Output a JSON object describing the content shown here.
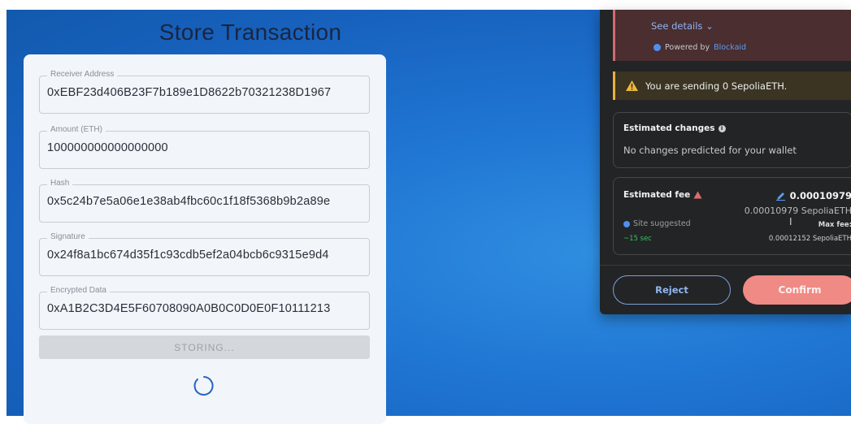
{
  "store": {
    "title": "Store Transaction",
    "fields": [
      {
        "label": "Receiver Address",
        "value": "0xEBF23d406B23F7b189e1D8622b70321238D1967"
      },
      {
        "label": "Amount (ETH)",
        "value": "100000000000000000"
      },
      {
        "label": "Hash",
        "value": "0x5c24b7e5a06e1e38ab4fbc60c1f18f5368b9b2a89e"
      },
      {
        "label": "Signature",
        "value": "0x24f8a1bc674d35f1c93cdb5ef2a04bcb6c9315e9d4"
      },
      {
        "label": "Encrypted Data",
        "value": "0xA1B2C3D4E5F60708090A0B0C0D0E0F10111213"
      }
    ],
    "button_label": "STORING..."
  },
  "metamask": {
    "see_details": "See details",
    "powered_by": "Powered by",
    "powered_brand": "Blockaid",
    "warning": "You are sending 0 SepoliaETH.",
    "estimated_changes_title": "Estimated changes",
    "estimated_changes_text": "No changes predicted for your wallet",
    "fee_title": "Estimated fee",
    "fee_main": "0.00010979",
    "fee_sub": "0.00010979 SepoliaETH",
    "site_suggested": "Site suggested",
    "time": "~15 sec",
    "max_fee_label": "Max fee:",
    "max_fee_value": "0.00012152 SepoliaETH",
    "reject_label": "Reject",
    "confirm_label": "Confirm"
  },
  "colors": {
    "background_blue": "#1f74d2",
    "popup_bg": "#232426",
    "confirm": "#f08a85",
    "warning": "#e9b23b",
    "danger": "#d36a6f"
  }
}
